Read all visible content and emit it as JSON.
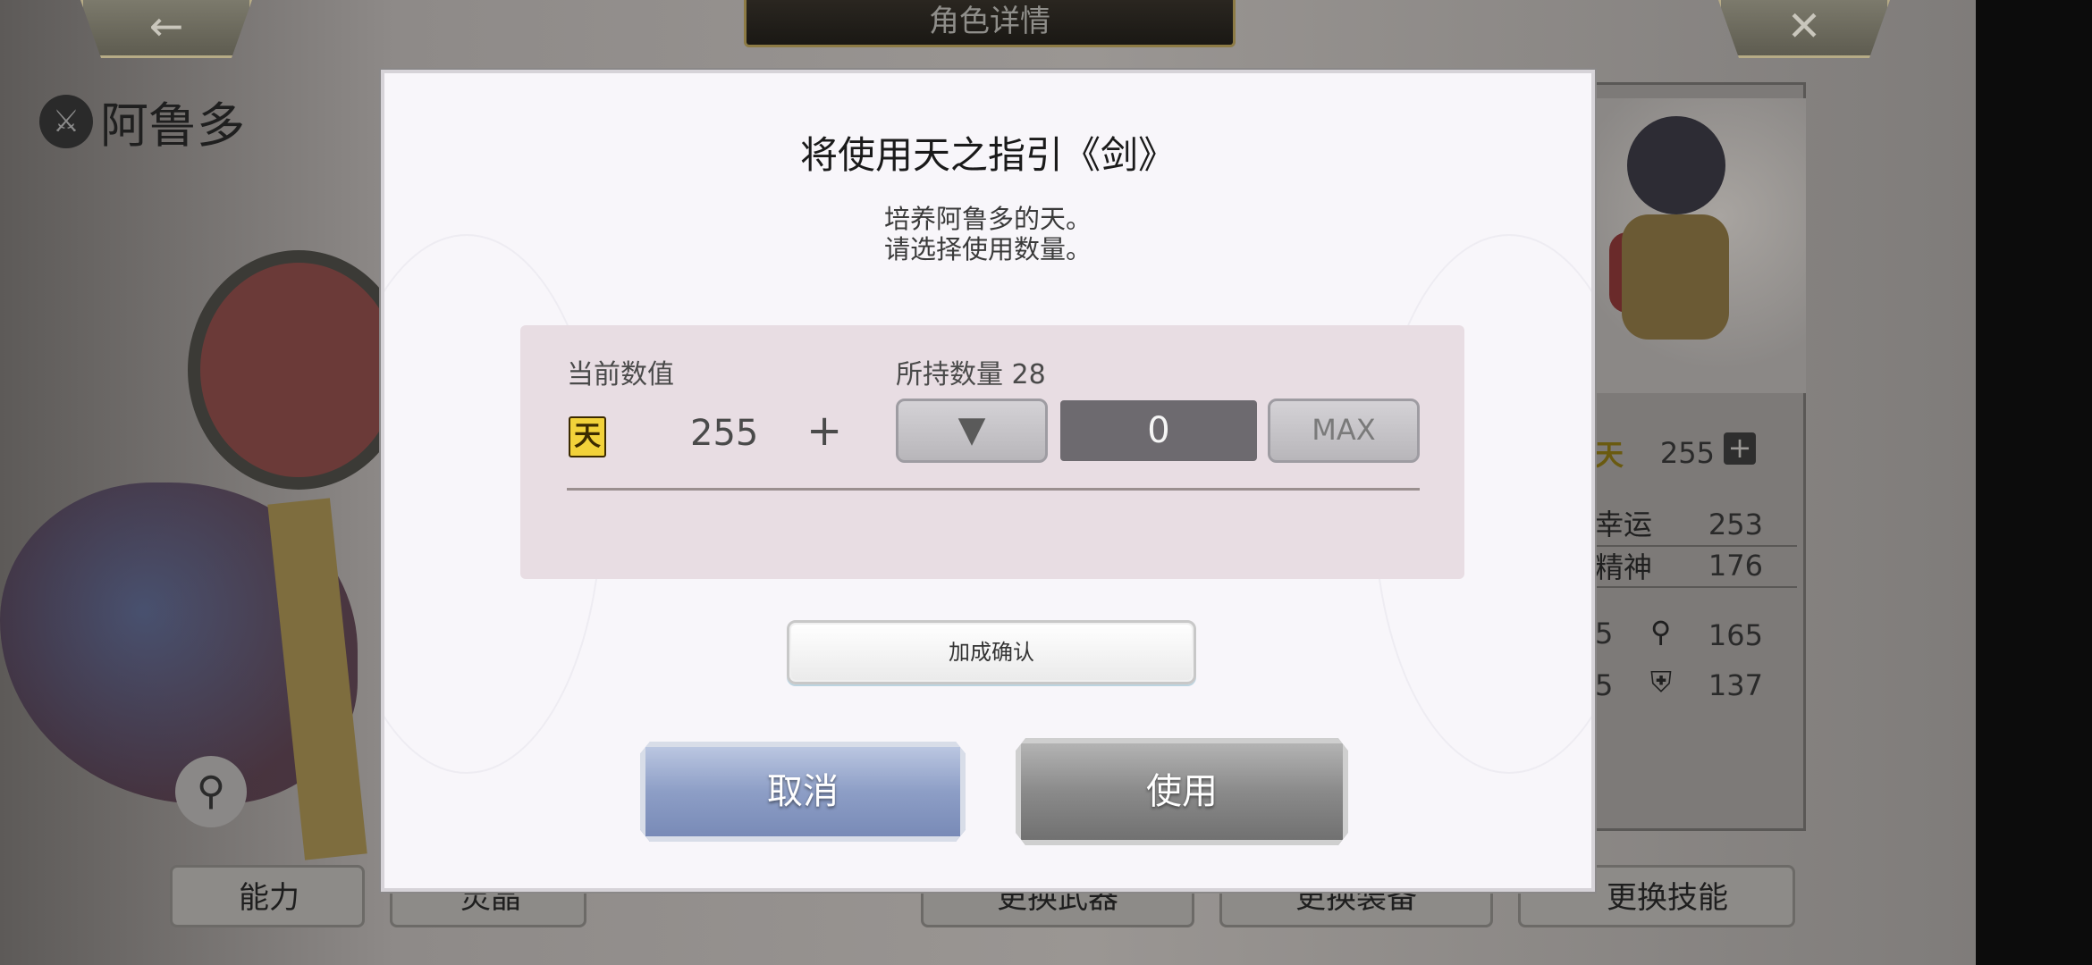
{
  "screen": {
    "title": "角色详情",
    "back_icon": "←",
    "close_icon": "✕"
  },
  "character": {
    "name": "阿鲁多",
    "emblem_icon": "⚔"
  },
  "side_stats": {
    "tian_value": "255",
    "rows": [
      {
        "label": "幸运",
        "value": "253"
      },
      {
        "label": "精神",
        "value": "176"
      }
    ],
    "extra": [
      {
        "partial": "5",
        "value": "165",
        "icon": "key-icon"
      },
      {
        "partial": "5",
        "value": "137",
        "icon": "shield-icon"
      }
    ]
  },
  "bottom_tabs": [
    {
      "label": "能力"
    },
    {
      "label": "灵晶"
    },
    {
      "label": "更换武器"
    },
    {
      "label": "更换装备"
    },
    {
      "label": "更换技能"
    }
  ],
  "dialog": {
    "title": "将使用天之指引《剑》",
    "description_line1": "培养阿鲁多的天。",
    "description_line2": "请选择使用数量。",
    "current_label": "当前数值",
    "owned_label": "所持数量 28",
    "tian_icon_text": "天",
    "current_value": "255",
    "plus_sign": "+",
    "decrease_symbol": "▼",
    "quantity": "0",
    "max_label": "MAX",
    "confirm_label": "加成确认",
    "cancel_label": "取消",
    "use_label": "使用"
  }
}
